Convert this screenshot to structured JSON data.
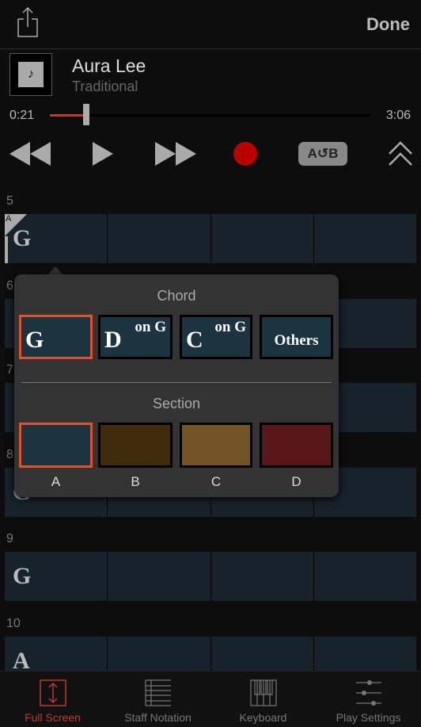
{
  "header": {
    "done_label": "Done",
    "share_icon": "share-icon"
  },
  "song": {
    "title": "Aura Lee",
    "artist": "Traditional",
    "art_icon": "♪"
  },
  "progress": {
    "current": "0:21",
    "total": "3:06",
    "fraction": 0.113
  },
  "controls": {
    "ab_label": "A↺B",
    "record_color": "#bb0000"
  },
  "measures": [
    {
      "number": "5",
      "chords": [
        "G",
        "",
        "",
        ""
      ],
      "section": "A"
    },
    {
      "number": "6",
      "chords": [
        "",
        "",
        "",
        ""
      ]
    },
    {
      "number": "7",
      "chords": [
        "",
        "",
        "",
        ""
      ]
    },
    {
      "number": "8",
      "chords": [
        "G",
        "",
        "",
        ""
      ]
    },
    {
      "number": "9",
      "chords": [
        "G",
        "",
        "",
        ""
      ]
    },
    {
      "number": "10",
      "chords": [
        "A",
        "",
        "",
        ""
      ]
    }
  ],
  "popover": {
    "chord_title": "Chord",
    "chords": [
      {
        "root": "G",
        "on": "",
        "selected": true
      },
      {
        "root": "D",
        "on": "on G"
      },
      {
        "root": "C",
        "on": "on G"
      },
      {
        "label": "Others"
      }
    ],
    "section_title": "Section",
    "sections": [
      {
        "label": "A",
        "color": "#1b3440",
        "selected": true
      },
      {
        "label": "B",
        "color": "#3f2a0c"
      },
      {
        "label": "C",
        "color": "#725325"
      },
      {
        "label": "D",
        "color": "#5a1719"
      }
    ]
  },
  "tabs": [
    {
      "label": "Full Screen",
      "active": true
    },
    {
      "label": "Staff Notation"
    },
    {
      "label": "Keyboard"
    },
    {
      "label": "Play Settings"
    }
  ],
  "accent": "#e0522f"
}
